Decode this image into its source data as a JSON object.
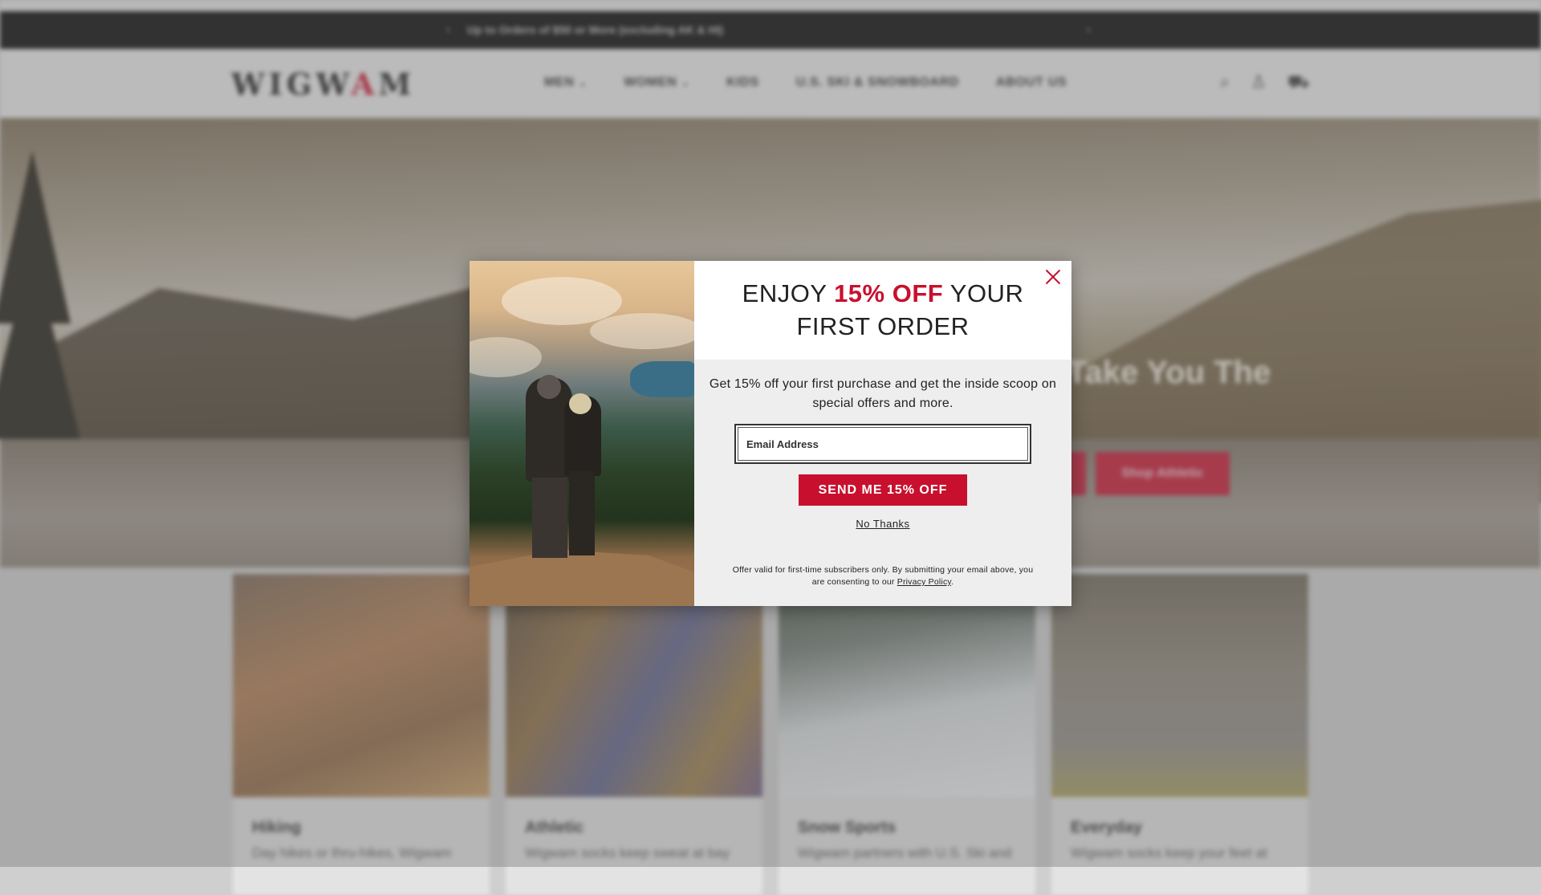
{
  "announcement": {
    "text": "Up to Orders of $50 or More (excluding AK & HI)",
    "prev_icon": "chevron-left-icon",
    "next_icon": "chevron-right-icon"
  },
  "header": {
    "logo_left": "WIGW",
    "logo_mid": "A",
    "logo_right": "M",
    "nav": [
      {
        "label": "MEN",
        "dropdown": true
      },
      {
        "label": "WOMEN",
        "dropdown": true
      },
      {
        "label": "KIDS",
        "dropdown": false
      },
      {
        "label": "U.S. SKI & SNOWBOARD",
        "dropdown": false
      },
      {
        "label": "ABOUT US",
        "dropdown": false
      }
    ],
    "icons": [
      "search-icon",
      "account-icon",
      "cart-icon"
    ]
  },
  "hero": {
    "title": "Take You The",
    "button_left": "",
    "button_right": "Shop Athletic"
  },
  "categories": [
    {
      "title": "Hiking",
      "desc": "Day hikes or thru-hikes, Wigwam"
    },
    {
      "title": "Athletic",
      "desc": "Wigwam socks keep sweat at bay"
    },
    {
      "title": "Snow Sports",
      "desc": "Wigwam partners with U.S. Ski and"
    },
    {
      "title": "Everyday",
      "desc": "Wigwam socks keep your feet at"
    }
  ],
  "popup": {
    "title_pre": "ENJOY ",
    "title_highlight": "15% OFF",
    "title_post": " YOUR",
    "title_line2": "FIRST ORDER",
    "body": "Get 15% off your first purchase and get the inside scoop on special offers and more.",
    "email_placeholder": "Email Address",
    "email_value": "",
    "submit_label": "SEND ME 15% OFF",
    "decline_label": "No Thanks",
    "fine_print": "Offer valid for first-time subscribers only. By submitting your email above, you are consenting to our ",
    "privacy_link": "Privacy Policy",
    "fine_print_end": ".",
    "close_icon": "close-icon"
  },
  "colors": {
    "brand_red": "#c8102e",
    "announcement_bg": "#000000"
  }
}
